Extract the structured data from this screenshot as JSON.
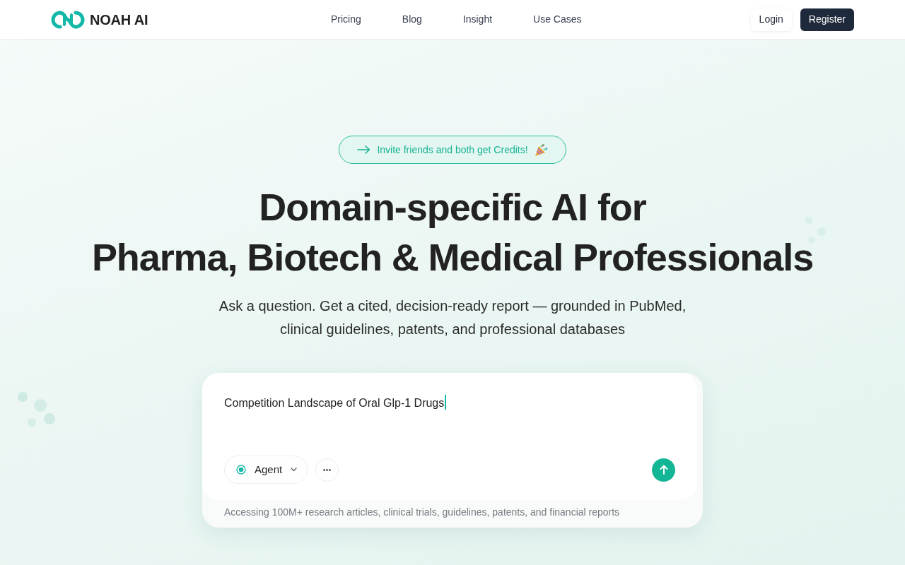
{
  "header": {
    "logo_text": "NOAH AI",
    "nav_links": [
      "Pricing",
      "Blog",
      "Insight",
      "Use Cases"
    ],
    "auth_buttons": [
      {
        "label": "Login",
        "kind": "secondary"
      },
      {
        "label": "Register",
        "kind": "primary"
      }
    ]
  },
  "hero": {
    "invite_banner": "Invite friends and both get Credits!",
    "title_lines": [
      "Domain-specific AI for",
      "Pharma, Biotech & Medical Professionals"
    ],
    "subtitle": "Ask a question. Get a cited, decision-ready report — grounded in PubMed, clinical guidelines, patents, and professional databases"
  },
  "prompt_box": {
    "value": "Competition Landscape of Oral Glp-1 Drugs",
    "focused": true,
    "mode_button": "Agent",
    "footer_note": "Accessing 100M+ research articles, clinical trials, guidelines, patents, and financial reports"
  }
}
